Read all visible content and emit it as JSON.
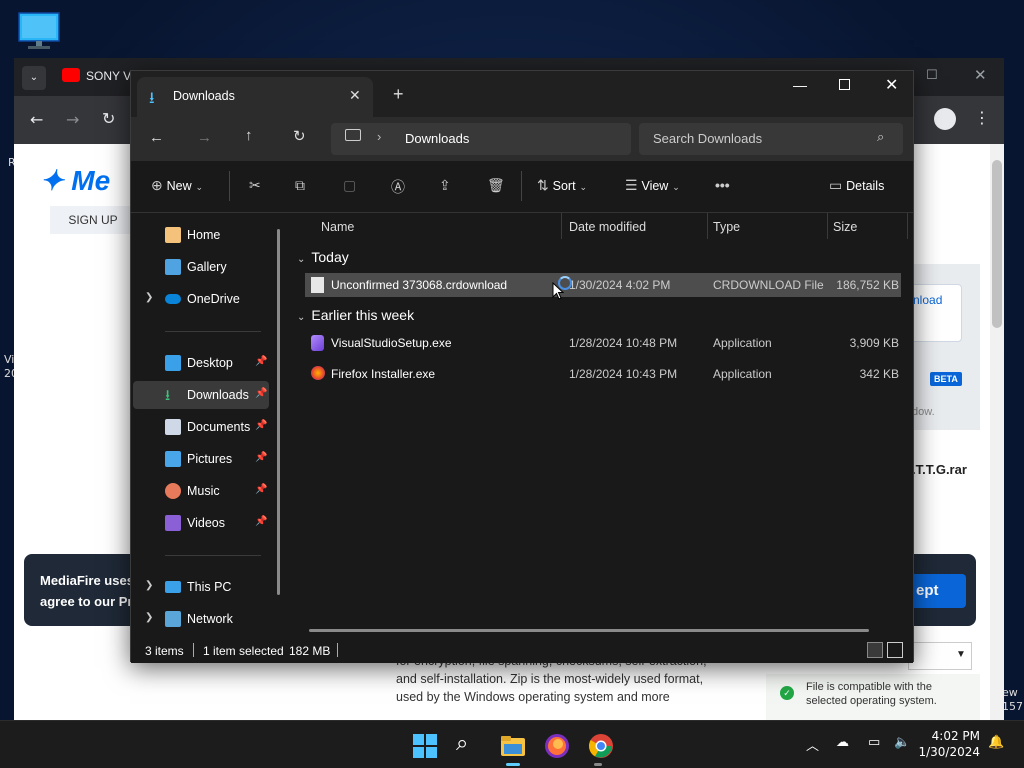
{
  "desktop": {
    "side_text_r": "R",
    "side_text_vi": "Vi\n20",
    "side_text_ew": "ew\n157"
  },
  "browser": {
    "tab_title": "SONY V",
    "page": {
      "logo_text": "Me",
      "signup_label": "SIGN UP",
      "download_link_text": "nload",
      "beta_badge": "BETA",
      "dow_text": "dow.",
      "filename_partial": ".T.T.G.rar",
      "cookie_text_line1": "MediaFire uses",
      "cookie_text_line2": "agree to our Pri",
      "accept_label": "ept",
      "zip_text": "for encryption, file spanning, checksums, self-extraction, and self-installation. Zip is the most-widely used format, used by the Windows operating system and more",
      "compat_text_line1": "File is compatible with the",
      "compat_text_line2": "selected operating system."
    }
  },
  "explorer": {
    "tab_title": "Downloads",
    "path_label": "Downloads",
    "search_placeholder": "Search Downloads",
    "commands": {
      "new_label": "New",
      "sort_label": "Sort",
      "view_label": "View",
      "details_label": "Details"
    },
    "nav_items": [
      {
        "label": "Home",
        "pinned": false
      },
      {
        "label": "Gallery",
        "pinned": false
      },
      {
        "label": "OneDrive",
        "pinned": false
      },
      {
        "label": "Desktop",
        "pinned": true
      },
      {
        "label": "Downloads",
        "pinned": true
      },
      {
        "label": "Documents",
        "pinned": true
      },
      {
        "label": "Pictures",
        "pinned": true
      },
      {
        "label": "Music",
        "pinned": true
      },
      {
        "label": "Videos",
        "pinned": true
      },
      {
        "label": "This PC",
        "pinned": false
      },
      {
        "label": "Network",
        "pinned": false
      }
    ],
    "columns": [
      "Name",
      "Date modified",
      "Type",
      "Size"
    ],
    "groups": [
      {
        "title": "Today",
        "files": [
          {
            "name": "Unconfirmed 373068.crdownload",
            "date": "1/30/2024 4:02 PM",
            "type": "CRDOWNLOAD File",
            "size": "186,752 KB",
            "selected": true
          }
        ]
      },
      {
        "title": "Earlier this week",
        "files": [
          {
            "name": "VisualStudioSetup.exe",
            "date": "1/28/2024 10:48 PM",
            "type": "Application",
            "size": "3,909 KB",
            "selected": false
          },
          {
            "name": "Firefox Installer.exe",
            "date": "1/28/2024 10:43 PM",
            "type": "Application",
            "size": "342 KB",
            "selected": false
          }
        ]
      }
    ],
    "status": {
      "item_count": "3 items",
      "selection": "1 item selected",
      "selection_size": "182 MB"
    }
  },
  "taskbar": {
    "time": "4:02 PM",
    "date": "1/30/2024"
  },
  "colors": {
    "accent": "#60cdff",
    "selected_row": "#4d4d4d",
    "explorer_bg": "#191919"
  }
}
